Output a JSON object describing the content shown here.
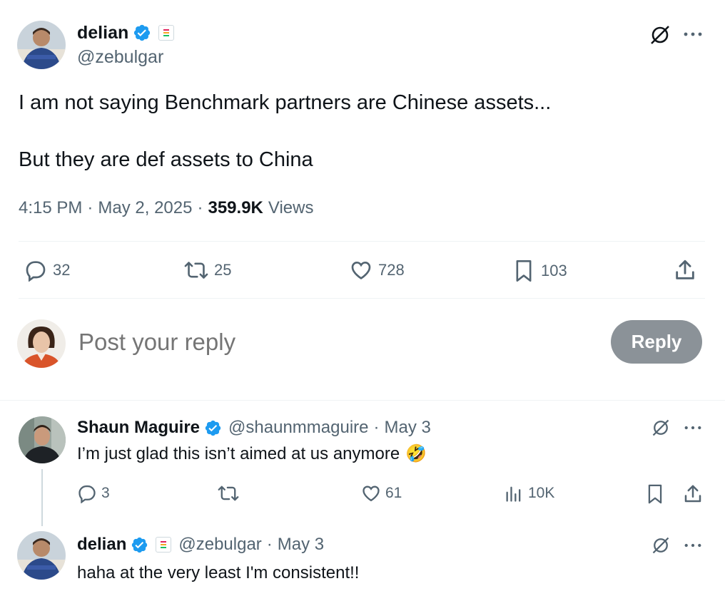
{
  "main_tweet": {
    "author_name": "delian",
    "handle": "@zebulgar",
    "text_line1": "I am not saying Benchmark partners are Chinese assets...",
    "text_line2": "But they are def assets to China",
    "time": "4:15 PM",
    "date": "May 2, 2025",
    "separator": "·",
    "views_count": "359.9K",
    "views_label": "Views",
    "stats": {
      "replies": "32",
      "reposts": "25",
      "likes": "728",
      "bookmarks": "103"
    }
  },
  "composer": {
    "placeholder": "Post your reply",
    "button_label": "Reply"
  },
  "replies": [
    {
      "author_name": "Shaun Maguire",
      "handle": "@shaunmmaguire",
      "date": "May 3",
      "separator": "·",
      "text": "I’m just glad this isn’t aimed at us anymore",
      "emoji": "🤣",
      "stats": {
        "replies": "3",
        "likes": "61",
        "views": "10K"
      }
    },
    {
      "author_name": "delian",
      "handle": "@zebulgar",
      "date": "May 3",
      "separator": "·",
      "text": "haha at the very least I'm consistent!!"
    }
  ],
  "colors": {
    "verified": "#1d9bf0",
    "muted": "#536471",
    "reply_button": "#8b9298"
  }
}
